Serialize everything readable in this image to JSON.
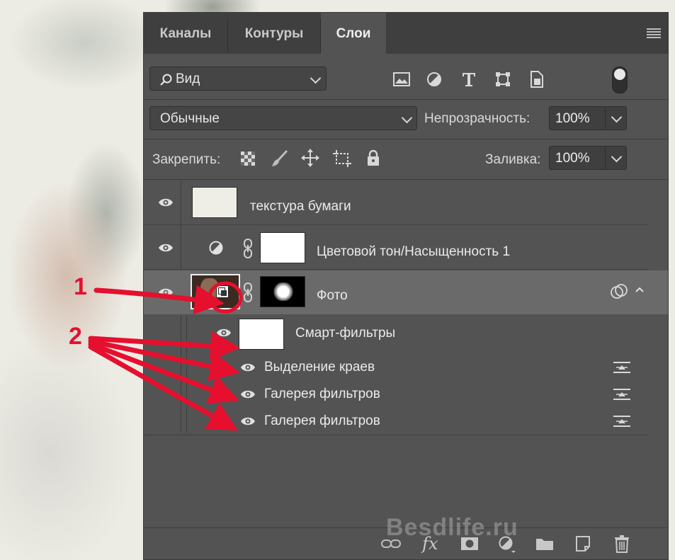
{
  "tabs": [
    {
      "label": "Каналы",
      "active": false
    },
    {
      "label": "Контуры",
      "active": false
    },
    {
      "label": "Слои",
      "active": true
    }
  ],
  "filter": {
    "value": "Вид"
  },
  "blend": {
    "mode": "Обычные",
    "opacity_label": "Непрозрачность:",
    "opacity": "100%"
  },
  "lock": {
    "label": "Закрепить:",
    "fill_label": "Заливка:",
    "fill": "100%"
  },
  "layers": [
    {
      "name": "текстура бумаги",
      "visible": true
    },
    {
      "name": "Цветовой тон/Насыщенность 1",
      "visible": true
    },
    {
      "name": "Фото",
      "visible": true,
      "selected": true
    },
    {
      "name": "Смарт-фильтры",
      "visible": true
    }
  ],
  "filters": [
    {
      "name": "Выделение краев"
    },
    {
      "name": "Галерея фильтров"
    },
    {
      "name": "Галерея фильтров"
    }
  ],
  "footer": {
    "fx_label": "fx"
  },
  "watermark": "Besdlife.ru",
  "annotations": {
    "marker1": "1",
    "marker2": "2",
    "color": "#e60f2e"
  },
  "colors": {
    "panel": "#535353",
    "tabbar": "#3f3f3f",
    "selected_row": "#6a6a6a"
  }
}
